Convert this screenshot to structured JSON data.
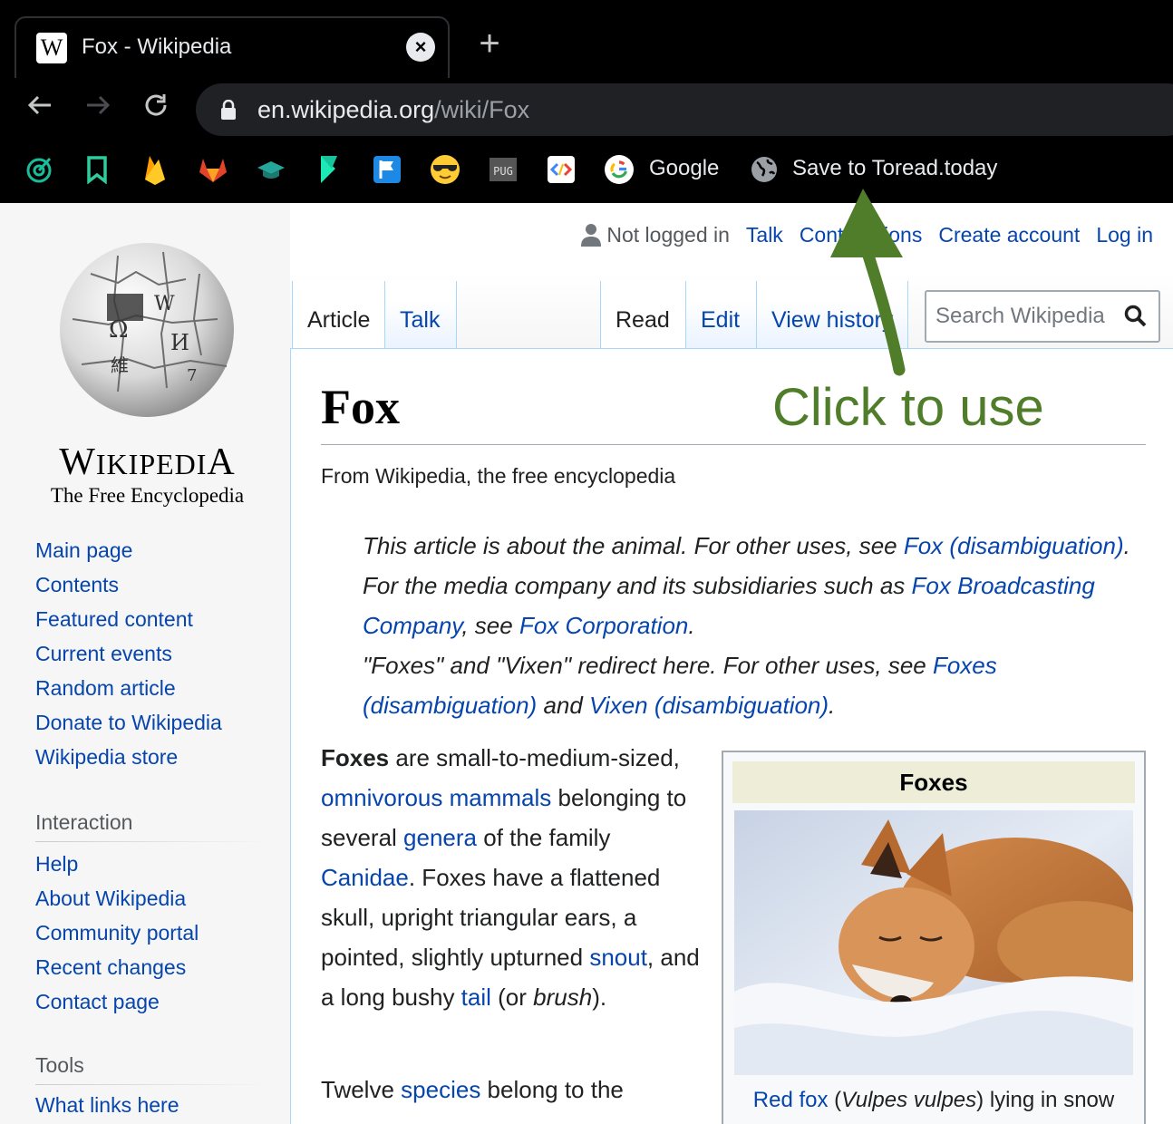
{
  "browser": {
    "tab": {
      "title": "Fox - Wikipedia",
      "favicon": "W"
    },
    "url": {
      "host": "en.wikipedia.org",
      "path": "/wiki/Fox"
    },
    "bookmarks": {
      "google_label": "Google",
      "toread_label": "Save to Toread.today"
    }
  },
  "wiki": {
    "logo": {
      "wordmark_big_w": "W",
      "wordmark_rest": "IKIPEDI",
      "wordmark_big_a": "A",
      "tagline": "The Free Encyclopedia"
    },
    "navigation": [
      "Main page",
      "Contents",
      "Featured content",
      "Current events",
      "Random article",
      "Donate to Wikipedia",
      "Wikipedia store"
    ],
    "interaction_heading": "Interaction",
    "interaction": [
      "Help",
      "About Wikipedia",
      "Community portal",
      "Recent changes",
      "Contact page"
    ],
    "tools_heading": "Tools",
    "tools": [
      "What links here"
    ],
    "personal": {
      "not_logged_in": "Not logged in",
      "talk": "Talk",
      "contributions": "Contributions",
      "create_account": "Create account",
      "log_in": "Log in"
    },
    "tabs": {
      "article": "Article",
      "talk": "Talk",
      "read": "Read",
      "edit": "Edit",
      "view_history": "View history"
    },
    "search_placeholder": "Search Wikipedia",
    "title": "Fox",
    "site_sub": "From Wikipedia, the free encyclopedia",
    "hatnote": {
      "t1": "This article is about the animal. For other uses, see ",
      "l1": "Fox (disambiguation)",
      "t2": ". For the media company and its subsidiaries such as ",
      "l2": "Fox Broadcasting Company",
      "t3": ", see ",
      "l3": "Fox Corporation",
      "t4": ".",
      "t5": "\"Foxes\" and \"Vixen\" redirect here. For other uses, see ",
      "l4": "Foxes (disambiguation)",
      "t6": " and ",
      "l5": "Vixen (disambiguation)",
      "t7": "."
    },
    "lead": {
      "bold": "Foxes",
      "t1": " are small-to-medium-sized, ",
      "l1": "omnivorous mammals",
      "t2": " belonging to several ",
      "l2": "genera",
      "t3": " of the family ",
      "l3": "Canidae",
      "t4": ". Foxes have a flattened skull, upright triangular ears, a pointed, slightly upturned ",
      "l4": "snout",
      "t5": ", and a long bushy ",
      "l5": "tail",
      "t6": " (or ",
      "i1": "brush",
      "t7": ")."
    },
    "lead2": {
      "t1": "Twelve ",
      "l1": "species",
      "t2": " belong to the"
    },
    "infobox": {
      "title": "Foxes",
      "caption_link": "Red fox",
      "caption_t1": " (",
      "caption_italic": "Vulpes vulpes",
      "caption_t2": ") lying in snow"
    }
  },
  "annotation": {
    "text": "Click to use",
    "color": "#4f7d29"
  },
  "colors": {
    "link": "#0645ad",
    "chrome_bg": "#000000",
    "sidebar_bg": "#f6f6f6"
  }
}
